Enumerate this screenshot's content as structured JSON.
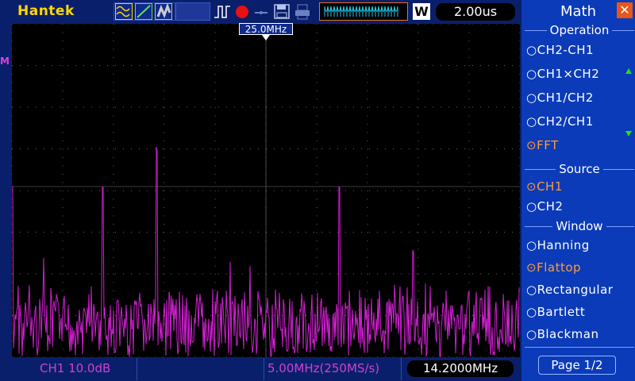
{
  "header": {
    "brand": "Hantek",
    "timebase": "2.00us",
    "acq_mode": "W"
  },
  "marker": {
    "label": "25.0MHz"
  },
  "ref_marker": "M",
  "status": {
    "channel_scale": "CH1 10.0dB",
    "sample_info": "5.00MHz(250MS/s)",
    "trigger_freq": "14.2000MHz"
  },
  "panel": {
    "title": "Math",
    "sections": [
      {
        "label": "Operation",
        "options": [
          {
            "label": "CH2-CH1",
            "selected": false
          },
          {
            "label": "CH1×CH2",
            "selected": false
          },
          {
            "label": "CH1/CH2",
            "selected": false
          },
          {
            "label": "CH2/CH1",
            "selected": false
          },
          {
            "label": "FFT",
            "selected": true
          }
        ]
      },
      {
        "label": "Source",
        "options": [
          {
            "label": "CH1",
            "selected": true
          },
          {
            "label": "CH2",
            "selected": false
          }
        ]
      },
      {
        "label": "Window",
        "options": [
          {
            "label": "Hanning",
            "selected": false
          },
          {
            "label": "Flattop",
            "selected": true
          },
          {
            "label": "Rectangular",
            "selected": false
          },
          {
            "label": "Bartlett",
            "selected": false
          },
          {
            "label": "Blackman",
            "selected": false
          }
        ]
      }
    ],
    "page": "Page 1/2"
  },
  "colors": {
    "trace": "#d020d0",
    "accent": "#e8741a",
    "selected": "#ff9a3c",
    "brand": "#ffd800"
  }
}
